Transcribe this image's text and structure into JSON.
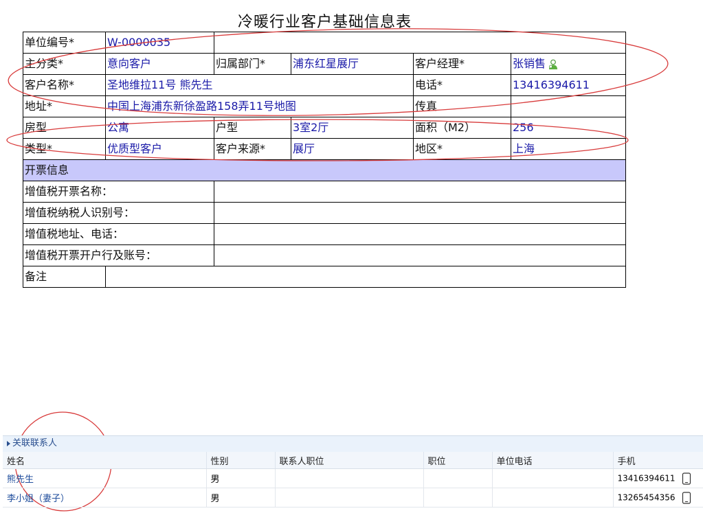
{
  "title": "冷暖行业客户基础信息表",
  "form": {
    "unit_no": {
      "label": "单位编号*",
      "value": "W-0000035"
    },
    "main_category": {
      "label": "主分类*",
      "value": "意向客户"
    },
    "department": {
      "label": "归属部门*",
      "value": "浦东红星展厅"
    },
    "manager": {
      "label": "客户经理*",
      "value": "张销售"
    },
    "customer_name": {
      "label": "客户名称*",
      "value": "圣地维拉11号 熊先生"
    },
    "phone": {
      "label": "电话*",
      "value": "13416394611"
    },
    "address": {
      "label": "地址*",
      "value": "中国上海浦东新徐盈路158弄11号",
      "map_link": "地图"
    },
    "fax": {
      "label": "传真",
      "value": ""
    },
    "house_type": {
      "label": "房型",
      "value": "公寓"
    },
    "layout": {
      "label": "户型",
      "value": "3室2厅"
    },
    "area": {
      "label": "面积（M2）",
      "value": "256"
    },
    "type": {
      "label": "类型*",
      "value": "优质型客户"
    },
    "source": {
      "label": "客户来源*",
      "value": "展厅"
    },
    "region": {
      "label": "地区*",
      "value": "上海"
    }
  },
  "invoice": {
    "section_label": "开票信息",
    "vat_name": "增值税开票名称：",
    "vat_taxpayer_id": "增值税纳税人识别号：",
    "vat_address_phone": "增值税地址、电话：",
    "vat_bank_account": "增值税开票开户行及账号："
  },
  "remarks_label": "备注",
  "contacts": {
    "section_label": "关联联系人",
    "columns": [
      "姓名",
      "性别",
      "联系人职位",
      "职位",
      "单位电话",
      "手机"
    ],
    "rows": [
      {
        "name": "熊先生",
        "gender": "男",
        "contact_position": "",
        "position": "",
        "office_phone": "",
        "mobile": "13416394611"
      },
      {
        "name": "李小姐（妻子）",
        "gender": "男",
        "contact_position": "",
        "position": "",
        "office_phone": "",
        "mobile": "13265454356"
      }
    ]
  },
  "colors": {
    "value_text": "#1a1aa8",
    "section_bg": "#c8c8fb",
    "annotation": "#d83a3a",
    "contacts_header_bg": "#eaf2fb"
  }
}
